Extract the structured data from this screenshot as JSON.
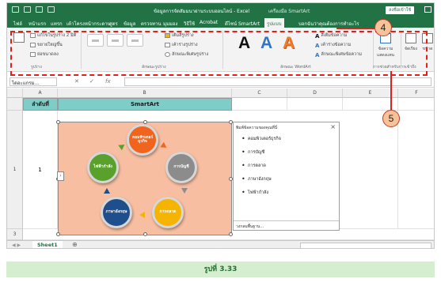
{
  "titlebar": {
    "doc_title": "ข้อมูลการจัดสัมมนาผ่านระบบออนไลน์ - Excel",
    "tools_title": "เครื่องมือ SmartArt",
    "signin": "ลงชื่อเข้าใช้"
  },
  "tabs": [
    {
      "label": "ไฟล์"
    },
    {
      "label": "หน้าแรก"
    },
    {
      "label": "แทรก"
    },
    {
      "label": "เค้าโครงหน้ากระดาษ"
    },
    {
      "label": "สูตร"
    },
    {
      "label": "ข้อมูล"
    },
    {
      "label": "ตรวจทาน"
    },
    {
      "label": "มุมมอง"
    },
    {
      "label": "วิธีใช้"
    },
    {
      "label": "Acrobat"
    },
    {
      "label": "ดีไซน์ SmartArt"
    },
    {
      "label": "รูปแบบ"
    },
    {
      "label": "บอกฉันว่าคุณต้องการทำอะไร"
    }
  ],
  "ribbon": {
    "shape_group": {
      "change_shape": "แก้ไขในรูปร่าง 2 มิติ",
      "larger": "ขยายใหญ่ขึ้น",
      "smaller": "ย่อขนาดลง",
      "label": "รูปร่าง"
    },
    "shape_styles": {
      "fill": "เติมสีรูปร่าง",
      "outline": "เค้าร่างรูปร่าง",
      "effects": "ลักษณะพิเศษรูปร่าง",
      "label": "ลักษณะรูปร่าง"
    },
    "wordart": {
      "letters": [
        "A",
        "A",
        "A"
      ],
      "fill": "สีเติมข้อความ",
      "outline": "เค้าร่างข้อความ",
      "effects": "ลักษณะพิเศษข้อความ",
      "label": "ลักษณะ WordArt"
    },
    "alt_text": "ข้อความแสดงแทน",
    "arrange": "จัดเรียง",
    "size": "ขนาด",
    "accessibility_label": "การช่วยสำหรับการเข้าถึง"
  },
  "formula_bar": {
    "name_box": "ไดอะแกรม...",
    "fx": "fx",
    "cancel": "✕",
    "enter": "✓"
  },
  "grid": {
    "columns": [
      "A",
      "B",
      "C",
      "D",
      "E",
      "F"
    ],
    "rows": [
      "1",
      "2",
      "3"
    ],
    "header_order": "ลำดับที่",
    "header_smartart": "SmartArt",
    "row1_number": "1"
  },
  "smartart_nodes": [
    {
      "label": "คอมพิวเตอร์ธุรกิจ",
      "color": "#f0641e"
    },
    {
      "label": "การบัญชี",
      "color": "#8c8c8c"
    },
    {
      "label": "การตลาด",
      "color": "#f5b400"
    },
    {
      "label": "ภาษาอังกฤษ",
      "color": "#1f4e8c"
    },
    {
      "label": "ไฟฟ้ากำลัง",
      "color": "#5aa02c"
    }
  ],
  "text_pane": {
    "title": "พิมพ์ข้อความของคุณที่นี่",
    "items": [
      "คอมพิวเตอร์ธุรกิจ",
      "การบัญชี",
      "การตลาด",
      "ภาษาอังกฤษ",
      "ไฟฟ้ากำลัง"
    ],
    "footer": "วงกลมพื้นฐาน...",
    "close": "×"
  },
  "sheet_tab": "Sheet1",
  "add_sheet": "⊕",
  "callouts": [
    "4",
    "5"
  ],
  "caption": "รูปที่ 3.33"
}
